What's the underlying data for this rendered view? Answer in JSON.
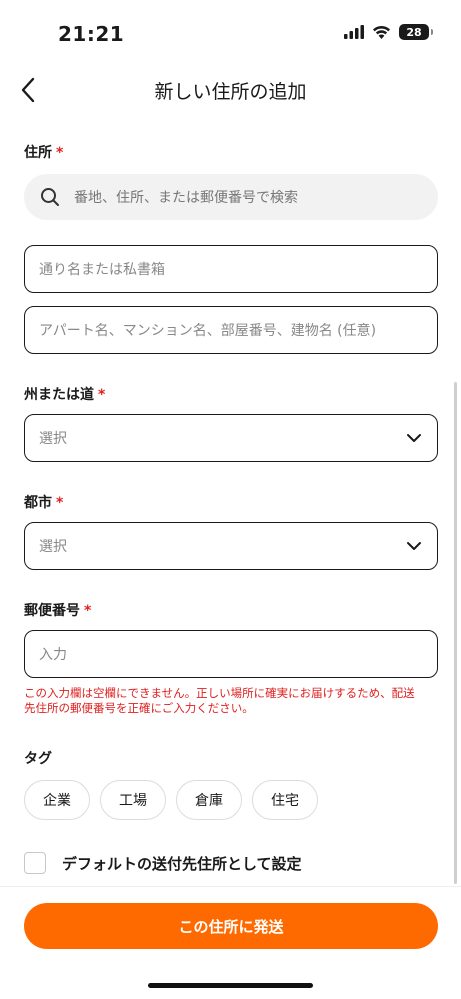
{
  "status_bar": {
    "time": "21:21",
    "battery": "28"
  },
  "header": {
    "title": "新しい住所の追加"
  },
  "address": {
    "label": "住所",
    "required_mark": "*",
    "search_placeholder": "番地、住所、または郵便番号で検索",
    "street_placeholder": "通り名または私書箱",
    "apartment_placeholder": "アパート名、マンション名、部屋番号、建物名 (任意)"
  },
  "state": {
    "label": "州または道",
    "required_mark": "*",
    "value": "選択"
  },
  "city": {
    "label": "都市",
    "required_mark": "*",
    "value": "選択"
  },
  "postal": {
    "label": "郵便番号",
    "required_mark": "*",
    "placeholder": "入力",
    "error_line1": "この入力欄は空欄にできません。正しい場所に確実にお届けするため、配送",
    "error_line2": "先住所の郵便番号を正確にご入力ください。"
  },
  "tags": {
    "label": "タグ",
    "items": [
      "企業",
      "工場",
      "倉庫",
      "住宅"
    ]
  },
  "default_address": {
    "label": "デフォルトの送付先住所として設定",
    "checked": false
  },
  "submit": {
    "label": "この住所に発送"
  },
  "colors": {
    "accent": "#ff6a00",
    "error": "#e02020",
    "search_bg": "#f2f2f2"
  },
  "icons": {
    "back": "chevron-left-icon",
    "search": "search-icon",
    "dropdown": "chevron-down-icon",
    "signal": "signal-icon",
    "wifi": "wifi-icon",
    "battery": "battery-icon"
  }
}
